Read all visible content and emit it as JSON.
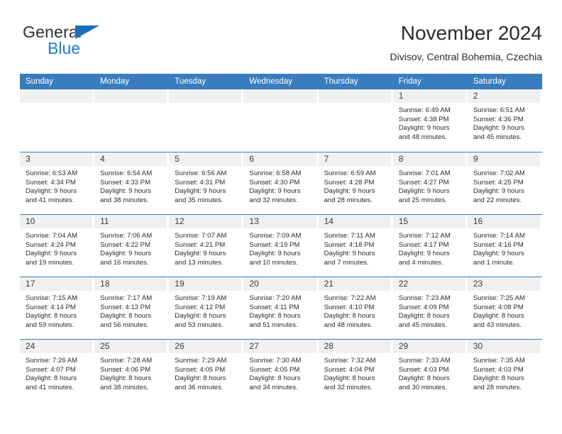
{
  "brand": {
    "name_top": "General",
    "name_bottom": "Blue",
    "triangle_color": "#1c6fba",
    "blue_color": "#1c7fd0"
  },
  "header": {
    "title": "November 2024",
    "location": "Divisov, Central Bohemia, Czechia"
  },
  "theme": {
    "header_blue": "#3a7dbf",
    "date_band": "#f0f0f0",
    "text": "#2b2b2b"
  },
  "calendar": {
    "weekdays": [
      "Sunday",
      "Monday",
      "Tuesday",
      "Wednesday",
      "Thursday",
      "Friday",
      "Saturday"
    ],
    "weeks": [
      [
        {
          "day": "",
          "lines": []
        },
        {
          "day": "",
          "lines": []
        },
        {
          "day": "",
          "lines": []
        },
        {
          "day": "",
          "lines": []
        },
        {
          "day": "",
          "lines": []
        },
        {
          "day": "1",
          "lines": [
            "Sunrise: 6:49 AM",
            "Sunset: 4:38 PM",
            "Daylight: 9 hours",
            "and 48 minutes."
          ]
        },
        {
          "day": "2",
          "lines": [
            "Sunrise: 6:51 AM",
            "Sunset: 4:36 PM",
            "Daylight: 9 hours",
            "and 45 minutes."
          ]
        }
      ],
      [
        {
          "day": "3",
          "lines": [
            "Sunrise: 6:53 AM",
            "Sunset: 4:34 PM",
            "Daylight: 9 hours",
            "and 41 minutes."
          ]
        },
        {
          "day": "4",
          "lines": [
            "Sunrise: 6:54 AM",
            "Sunset: 4:33 PM",
            "Daylight: 9 hours",
            "and 38 minutes."
          ]
        },
        {
          "day": "5",
          "lines": [
            "Sunrise: 6:56 AM",
            "Sunset: 4:31 PM",
            "Daylight: 9 hours",
            "and 35 minutes."
          ]
        },
        {
          "day": "6",
          "lines": [
            "Sunrise: 6:58 AM",
            "Sunset: 4:30 PM",
            "Daylight: 9 hours",
            "and 32 minutes."
          ]
        },
        {
          "day": "7",
          "lines": [
            "Sunrise: 6:59 AM",
            "Sunset: 4:28 PM",
            "Daylight: 9 hours",
            "and 28 minutes."
          ]
        },
        {
          "day": "8",
          "lines": [
            "Sunrise: 7:01 AM",
            "Sunset: 4:27 PM",
            "Daylight: 9 hours",
            "and 25 minutes."
          ]
        },
        {
          "day": "9",
          "lines": [
            "Sunrise: 7:02 AM",
            "Sunset: 4:25 PM",
            "Daylight: 9 hours",
            "and 22 minutes."
          ]
        }
      ],
      [
        {
          "day": "10",
          "lines": [
            "Sunrise: 7:04 AM",
            "Sunset: 4:24 PM",
            "Daylight: 9 hours",
            "and 19 minutes."
          ]
        },
        {
          "day": "11",
          "lines": [
            "Sunrise: 7:06 AM",
            "Sunset: 4:22 PM",
            "Daylight: 9 hours",
            "and 16 minutes."
          ]
        },
        {
          "day": "12",
          "lines": [
            "Sunrise: 7:07 AM",
            "Sunset: 4:21 PM",
            "Daylight: 9 hours",
            "and 13 minutes."
          ]
        },
        {
          "day": "13",
          "lines": [
            "Sunrise: 7:09 AM",
            "Sunset: 4:19 PM",
            "Daylight: 9 hours",
            "and 10 minutes."
          ]
        },
        {
          "day": "14",
          "lines": [
            "Sunrise: 7:11 AM",
            "Sunset: 4:18 PM",
            "Daylight: 9 hours",
            "and 7 minutes."
          ]
        },
        {
          "day": "15",
          "lines": [
            "Sunrise: 7:12 AM",
            "Sunset: 4:17 PM",
            "Daylight: 9 hours",
            "and 4 minutes."
          ]
        },
        {
          "day": "16",
          "lines": [
            "Sunrise: 7:14 AM",
            "Sunset: 4:16 PM",
            "Daylight: 9 hours",
            "and 1 minute."
          ]
        }
      ],
      [
        {
          "day": "17",
          "lines": [
            "Sunrise: 7:15 AM",
            "Sunset: 4:14 PM",
            "Daylight: 8 hours",
            "and 59 minutes."
          ]
        },
        {
          "day": "18",
          "lines": [
            "Sunrise: 7:17 AM",
            "Sunset: 4:13 PM",
            "Daylight: 8 hours",
            "and 56 minutes."
          ]
        },
        {
          "day": "19",
          "lines": [
            "Sunrise: 7:19 AM",
            "Sunset: 4:12 PM",
            "Daylight: 8 hours",
            "and 53 minutes."
          ]
        },
        {
          "day": "20",
          "lines": [
            "Sunrise: 7:20 AM",
            "Sunset: 4:11 PM",
            "Daylight: 8 hours",
            "and 51 minutes."
          ]
        },
        {
          "day": "21",
          "lines": [
            "Sunrise: 7:22 AM",
            "Sunset: 4:10 PM",
            "Daylight: 8 hours",
            "and 48 minutes."
          ]
        },
        {
          "day": "22",
          "lines": [
            "Sunrise: 7:23 AM",
            "Sunset: 4:09 PM",
            "Daylight: 8 hours",
            "and 45 minutes."
          ]
        },
        {
          "day": "23",
          "lines": [
            "Sunrise: 7:25 AM",
            "Sunset: 4:08 PM",
            "Daylight: 8 hours",
            "and 43 minutes."
          ]
        }
      ],
      [
        {
          "day": "24",
          "lines": [
            "Sunrise: 7:26 AM",
            "Sunset: 4:07 PM",
            "Daylight: 8 hours",
            "and 41 minutes."
          ]
        },
        {
          "day": "25",
          "lines": [
            "Sunrise: 7:28 AM",
            "Sunset: 4:06 PM",
            "Daylight: 8 hours",
            "and 38 minutes."
          ]
        },
        {
          "day": "26",
          "lines": [
            "Sunrise: 7:29 AM",
            "Sunset: 4:05 PM",
            "Daylight: 8 hours",
            "and 36 minutes."
          ]
        },
        {
          "day": "27",
          "lines": [
            "Sunrise: 7:30 AM",
            "Sunset: 4:05 PM",
            "Daylight: 8 hours",
            "and 34 minutes."
          ]
        },
        {
          "day": "28",
          "lines": [
            "Sunrise: 7:32 AM",
            "Sunset: 4:04 PM",
            "Daylight: 8 hours",
            "and 32 minutes."
          ]
        },
        {
          "day": "29",
          "lines": [
            "Sunrise: 7:33 AM",
            "Sunset: 4:03 PM",
            "Daylight: 8 hours",
            "and 30 minutes."
          ]
        },
        {
          "day": "30",
          "lines": [
            "Sunrise: 7:35 AM",
            "Sunset: 4:03 PM",
            "Daylight: 8 hours",
            "and 28 minutes."
          ]
        }
      ]
    ]
  }
}
